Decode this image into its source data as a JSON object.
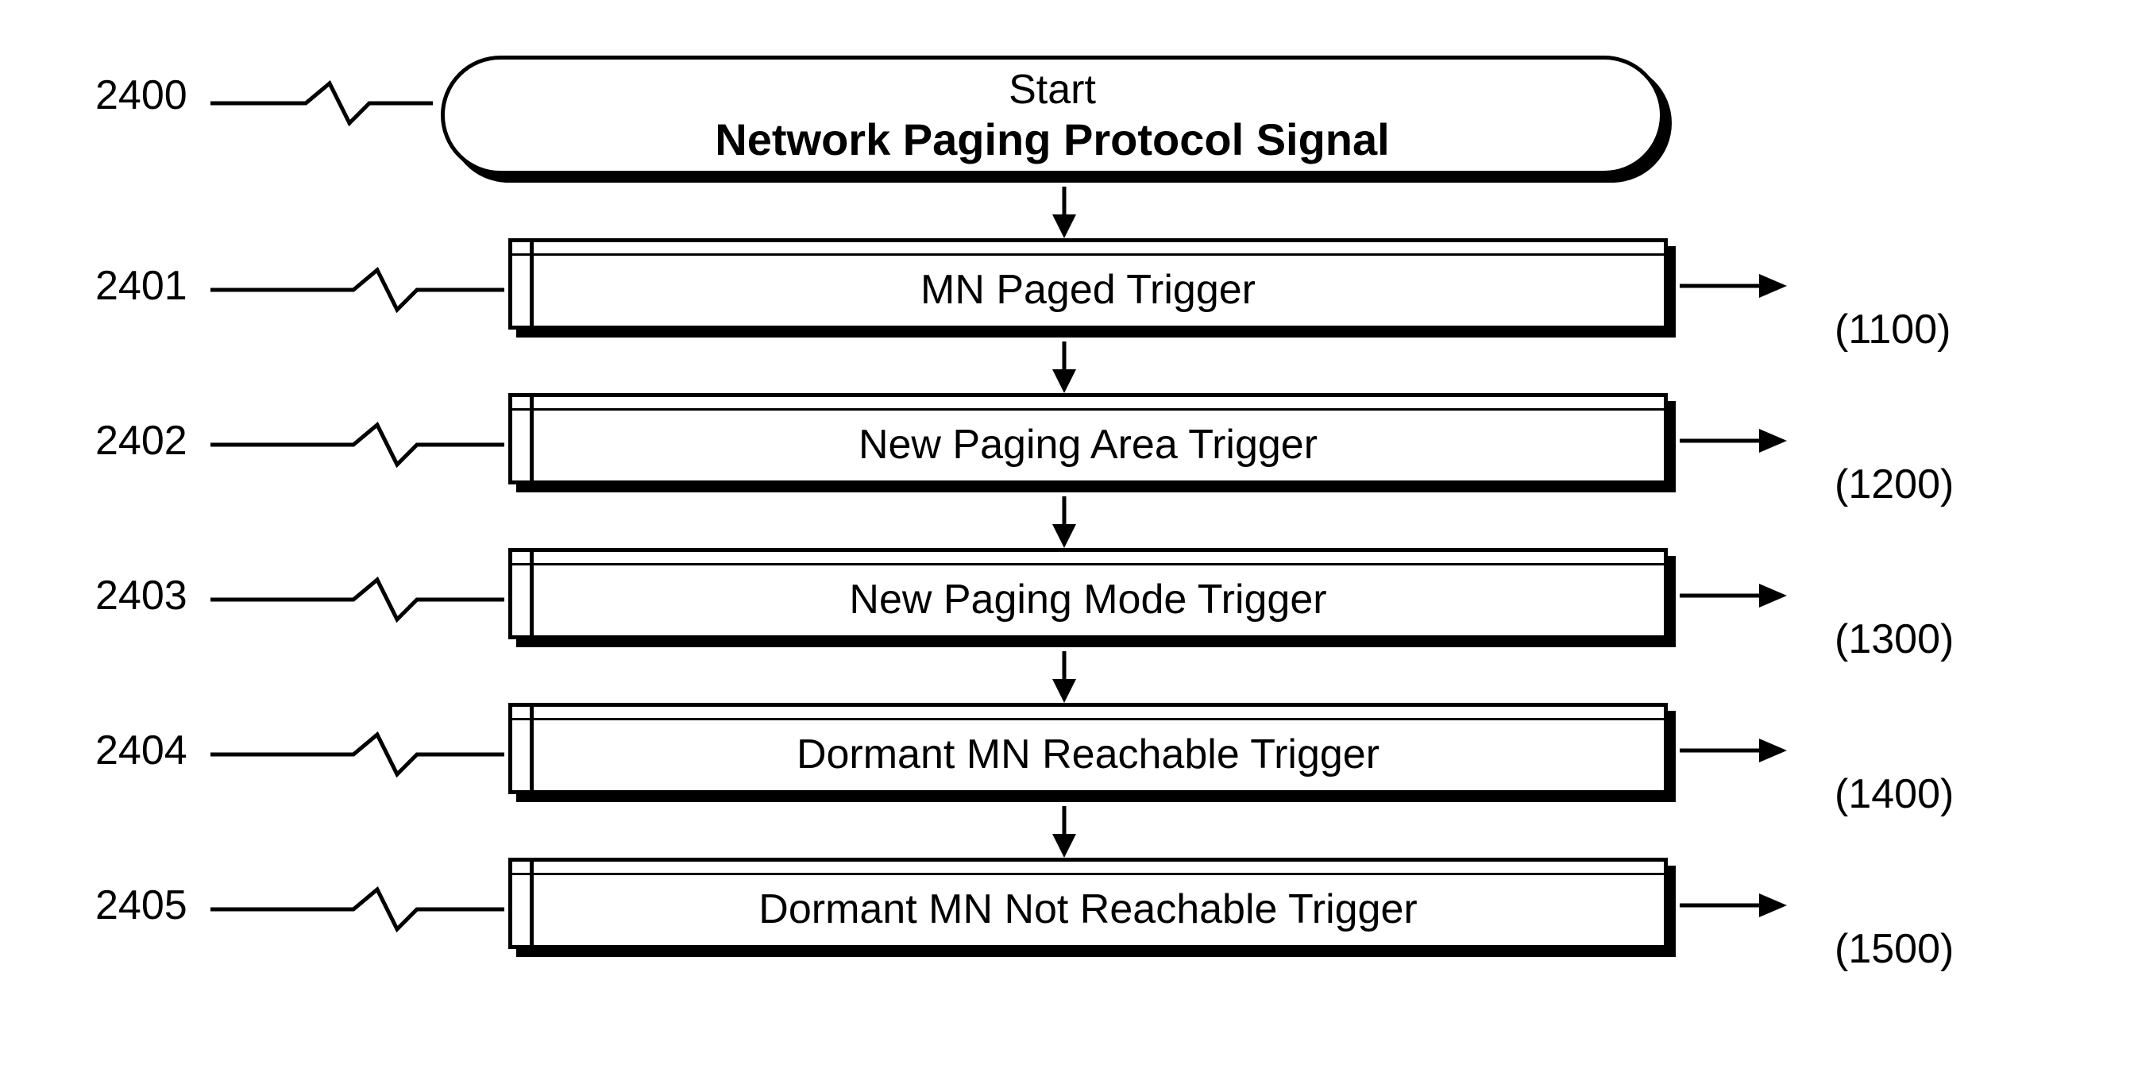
{
  "start": {
    "line1": "Start",
    "line2": "Network Paging Protocol Signal"
  },
  "left_refs": {
    "r0": "2400",
    "r1": "2401",
    "r2": "2402",
    "r3": "2403",
    "r4": "2404",
    "r5": "2405"
  },
  "right_refs": {
    "r1": "(1100)",
    "r2": "(1200)",
    "r3": "(1300)",
    "r4": "(1400)",
    "r5": "(1500)"
  },
  "steps": {
    "s1": "MN Paged Trigger",
    "s2": "New Paging Area Trigger",
    "s3": "New Paging Mode Trigger",
    "s4": "Dormant MN Reachable Trigger",
    "s5": "Dormant MN Not Reachable Trigger"
  }
}
